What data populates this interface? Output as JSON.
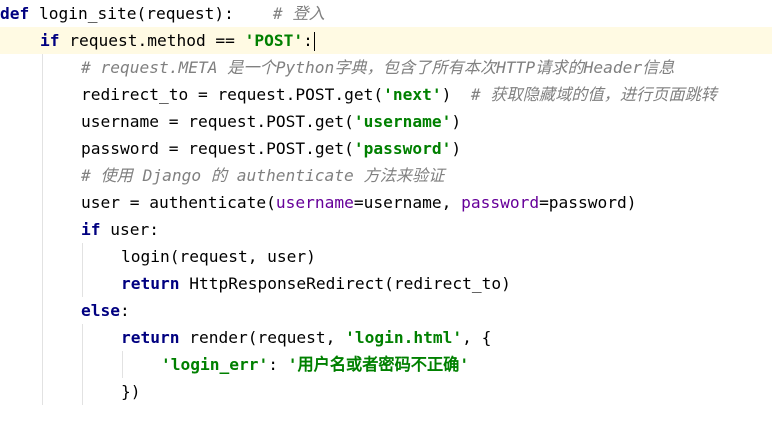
{
  "lines": [
    [
      {
        "t": "def",
        "c": "kw"
      },
      {
        "t": " login_site(request):    ",
        "c": ""
      },
      {
        "t": "# 登入",
        "c": "cmt"
      }
    ],
    [
      {
        "t": "if",
        "c": "kw"
      },
      {
        "t": " request.method == ",
        "c": ""
      },
      {
        "t": "'POST'",
        "c": "str"
      },
      {
        "t": ":",
        "c": ""
      }
    ],
    [
      {
        "t": "# request.META 是一个Python字典，包含了所有本次HTTP请求的Header信息",
        "c": "cmt"
      }
    ],
    [
      {
        "t": "redirect_to = request.POST.get(",
        "c": ""
      },
      {
        "t": "'next'",
        "c": "str"
      },
      {
        "t": ")  ",
        "c": ""
      },
      {
        "t": "# 获取隐藏域的值，进行页面跳转",
        "c": "cmt"
      }
    ],
    [
      {
        "t": "username = request.POST.get(",
        "c": ""
      },
      {
        "t": "'username'",
        "c": "str"
      },
      {
        "t": ")",
        "c": ""
      }
    ],
    [
      {
        "t": "password = request.POST.get(",
        "c": ""
      },
      {
        "t": "'password'",
        "c": "str"
      },
      {
        "t": ")",
        "c": ""
      }
    ],
    [
      {
        "t": "# 使用 Django 的 authenticate 方法来验证",
        "c": "cmt"
      }
    ],
    [
      {
        "t": "user = authenticate(",
        "c": ""
      },
      {
        "t": "username",
        "c": "kwarg"
      },
      {
        "t": "=username, ",
        "c": ""
      },
      {
        "t": "password",
        "c": "kwarg"
      },
      {
        "t": "=password)",
        "c": ""
      }
    ],
    [
      {
        "t": "if",
        "c": "kw"
      },
      {
        "t": " user:",
        "c": ""
      }
    ],
    [
      {
        "t": "login(request, user)",
        "c": ""
      }
    ],
    [
      {
        "t": "return",
        "c": "kw"
      },
      {
        "t": " HttpResponseRedirect(redirect_to)",
        "c": ""
      }
    ],
    [
      {
        "t": "else",
        "c": "kw"
      },
      {
        "t": ":",
        "c": ""
      }
    ],
    [
      {
        "t": "return",
        "c": "kw"
      },
      {
        "t": " render(request, ",
        "c": ""
      },
      {
        "t": "'login.html'",
        "c": "str"
      },
      {
        "t": ", {",
        "c": ""
      }
    ],
    [
      {
        "t": "'login_err'",
        "c": "str"
      },
      {
        "t": ": ",
        "c": ""
      },
      {
        "t": "'用户名或者密码不正确'",
        "c": "str"
      }
    ],
    [
      {
        "t": "})",
        "c": ""
      }
    ]
  ]
}
